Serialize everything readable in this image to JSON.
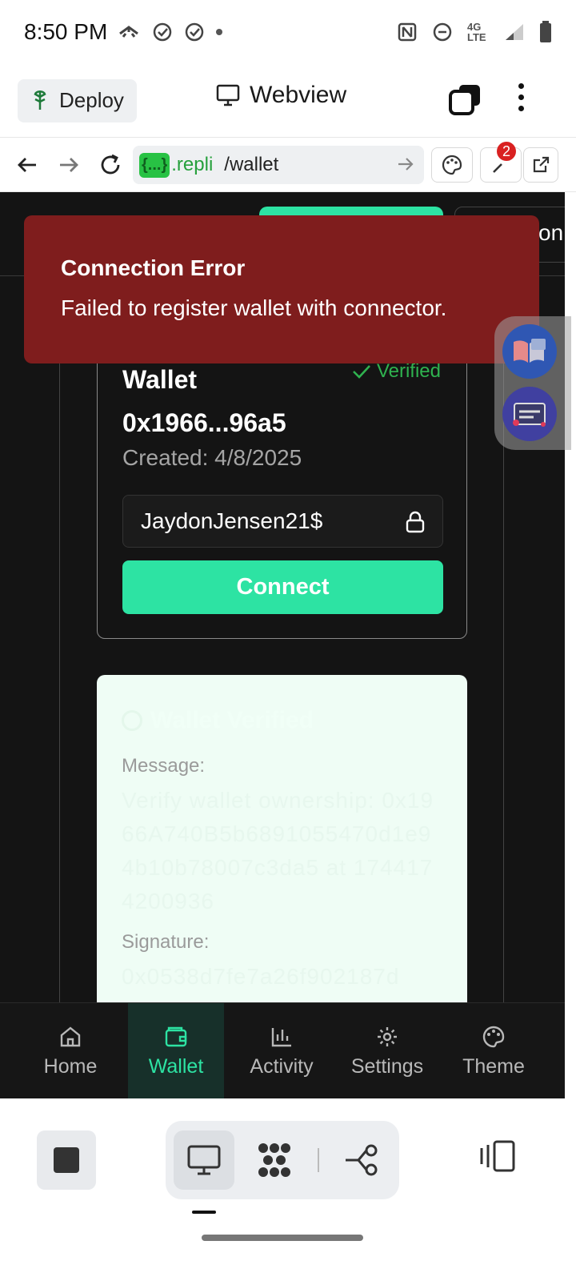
{
  "status_bar": {
    "time": "8:50 PM",
    "network": "4G LTE"
  },
  "toolbar": {
    "deploy_label": "Deploy",
    "title": "Webview"
  },
  "url_bar": {
    "chip": "{...}",
    "host": ".repli",
    "path": "/wallet",
    "devtools_badge": "2"
  },
  "webview": {
    "top_right_fragment": "on",
    "wallet_card": {
      "verified_label": "Verified",
      "name": "Wallet",
      "address": "0x1966...96a5",
      "created": "Created: 4/8/2025",
      "password_value": "JaydonJensen21$",
      "connect_label": "Connect"
    },
    "verify_card": {
      "title": "Wallet Verified",
      "message_label": "Message:",
      "message_value": "Verify wallet ownership: 0x1966A740B5b6891055470d1e94b10b78007c3da5 at 1744174200936",
      "signature_label": "Signature:",
      "signature_value": "0x0538d7fe7a26f902187d"
    },
    "nav": [
      {
        "label": "Home"
      },
      {
        "label": "Wallet"
      },
      {
        "label": "Activity"
      },
      {
        "label": "Settings"
      },
      {
        "label": "Theme"
      }
    ]
  },
  "toast": {
    "title": "Connection Error",
    "message": "Failed to register wallet with connector."
  },
  "colors": {
    "accent": "#2de3a3",
    "error_bg": "#7f1d1d",
    "webview_bg": "#141414",
    "verified": "#2fb24f"
  }
}
